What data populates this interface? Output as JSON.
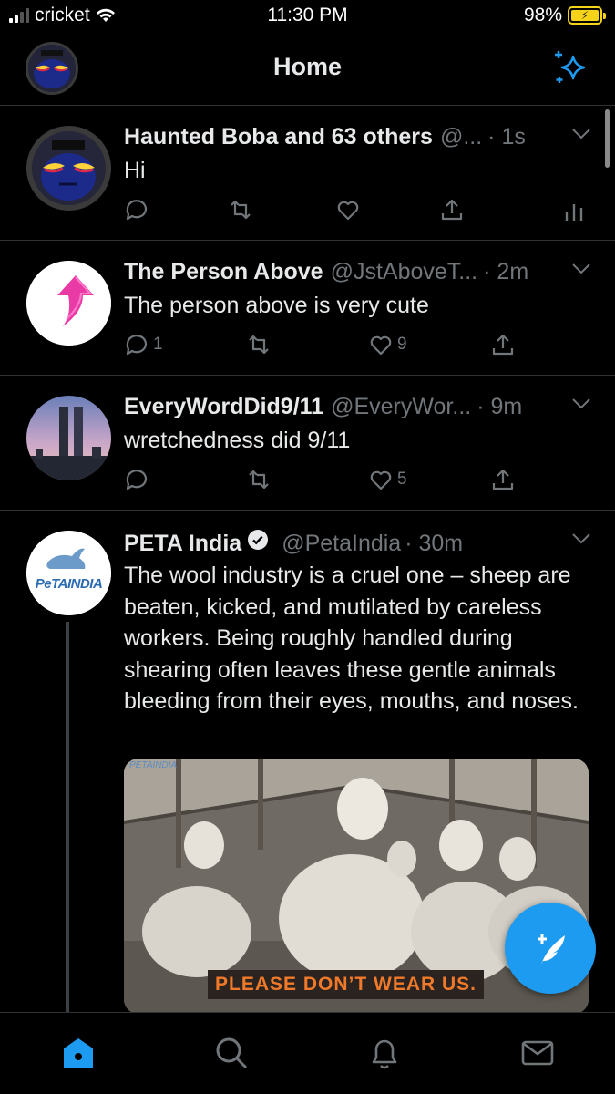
{
  "status_bar": {
    "carrier": "cricket",
    "time": "11:30 PM",
    "battery": "98%"
  },
  "header": {
    "title": "Home"
  },
  "tweets": [
    {
      "name": "Haunted Boba and 63 others",
      "handle": "@...",
      "time": "· 1s",
      "text": "Hi",
      "reply_count": "",
      "retweet_count": "",
      "like_count": ""
    },
    {
      "name": "The Person Above",
      "handle": "@JstAboveT...",
      "time": "· 2m",
      "text": "The person above is very cute",
      "reply_count": "1",
      "retweet_count": "",
      "like_count": "9"
    },
    {
      "name": "EveryWordDid9/11",
      "handle": "@EveryWor...",
      "time": "· 9m",
      "text": "wretchedness did 9/11",
      "reply_count": "",
      "retweet_count": "",
      "like_count": "5"
    },
    {
      "name": "PETA India",
      "handle": "@PetaIndia",
      "time": "· 30m",
      "text": "The wool industry is a cruel one – sheep are beaten, kicked, and mutilated by careless workers. Being roughly handled during shearing often leaves these gentle animals bleeding from their eyes, mouths, and noses.",
      "media_caption": "PLEASE DON’T WEAR US.",
      "media_watermark": "PETAINDIA",
      "avatar_text": "PeTAINDIA"
    }
  ],
  "icons": {
    "sparkle": "sparkle-icon",
    "compose": "feather-plus-icon",
    "tabs": [
      "home-icon",
      "search-icon",
      "bell-icon",
      "mail-icon"
    ]
  },
  "colors": {
    "accent": "#1d9bf0",
    "background": "#000000",
    "muted": "#71767b",
    "battery": "#f5d31b"
  }
}
